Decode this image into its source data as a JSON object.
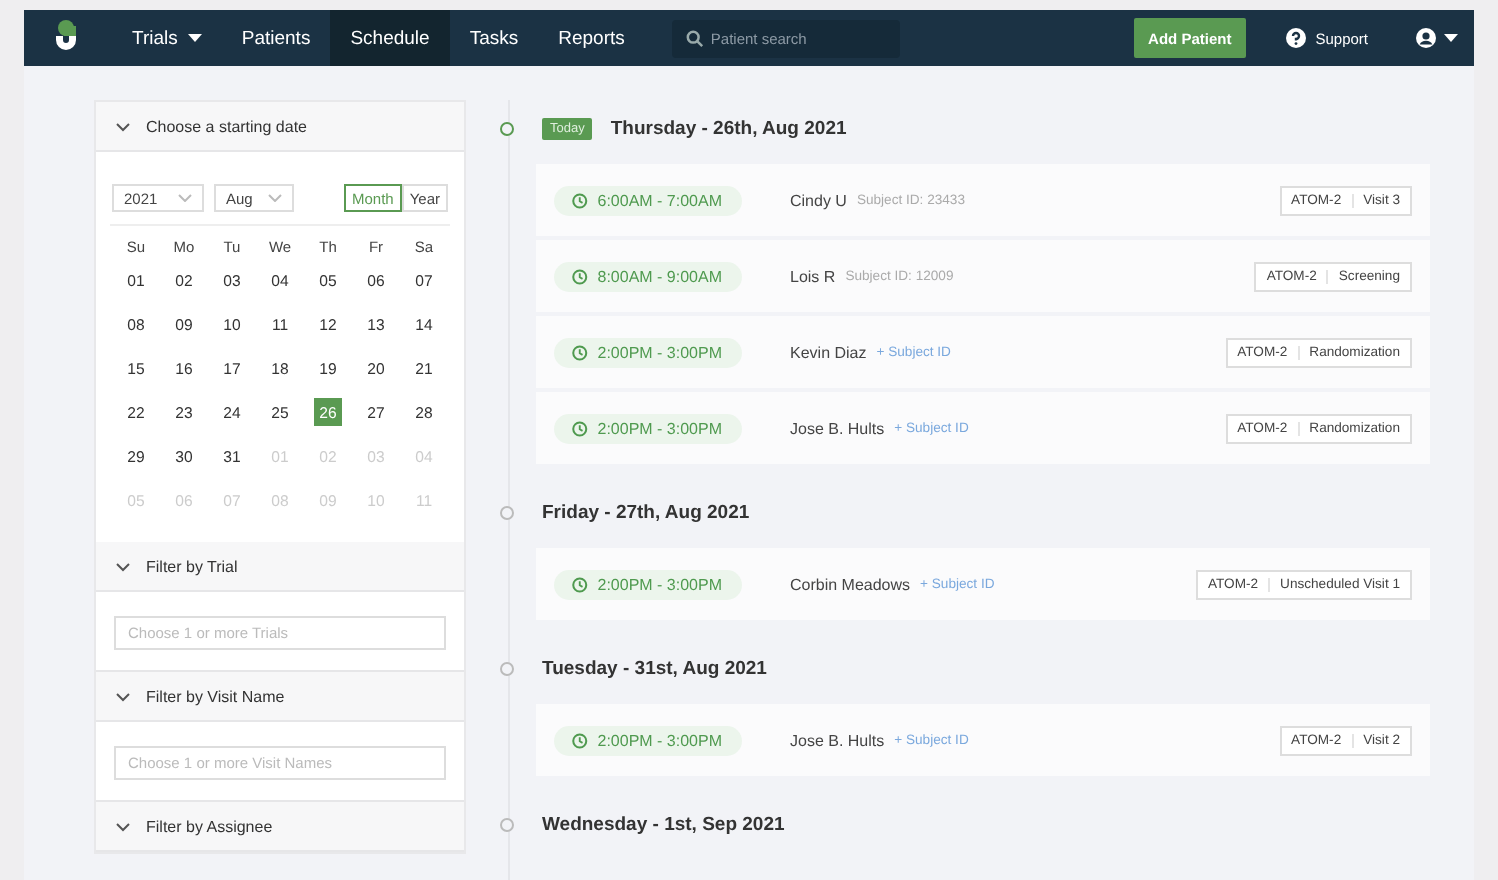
{
  "nav": {
    "items": [
      {
        "label": "Trials",
        "kind": "menu",
        "selected": false
      },
      {
        "label": "Patients",
        "kind": "link",
        "selected": false
      },
      {
        "label": "Schedule",
        "kind": "link",
        "selected": true
      },
      {
        "label": "Tasks",
        "kind": "link",
        "selected": false
      },
      {
        "label": "Reports",
        "kind": "link",
        "selected": false
      }
    ],
    "search": {
      "placeholder": "Patient search"
    },
    "add_button": "Add Patient",
    "support": "Support"
  },
  "sidebar": {
    "date_section": {
      "title": "Choose a starting date",
      "expanded": true,
      "year": "2021",
      "month": "Aug",
      "modes": [
        {
          "label": "Month",
          "selected": true
        },
        {
          "label": "Year",
          "selected": false
        }
      ],
      "weekdays": [
        "Su",
        "Mo",
        "Tu",
        "We",
        "Th",
        "Fr",
        "Sa"
      ],
      "weeks": [
        [
          {
            "d": "01",
            "muted": false,
            "selected": false
          },
          {
            "d": "02",
            "muted": false,
            "selected": false
          },
          {
            "d": "03",
            "muted": false,
            "selected": false
          },
          {
            "d": "04",
            "muted": false,
            "selected": false
          },
          {
            "d": "05",
            "muted": false,
            "selected": false
          },
          {
            "d": "06",
            "muted": false,
            "selected": false
          },
          {
            "d": "07",
            "muted": false,
            "selected": false
          }
        ],
        [
          {
            "d": "08",
            "muted": false,
            "selected": false
          },
          {
            "d": "09",
            "muted": false,
            "selected": false
          },
          {
            "d": "10",
            "muted": false,
            "selected": false
          },
          {
            "d": "11",
            "muted": false,
            "selected": false
          },
          {
            "d": "12",
            "muted": false,
            "selected": false
          },
          {
            "d": "13",
            "muted": false,
            "selected": false
          },
          {
            "d": "14",
            "muted": false,
            "selected": false
          }
        ],
        [
          {
            "d": "15",
            "muted": false,
            "selected": false
          },
          {
            "d": "16",
            "muted": false,
            "selected": false
          },
          {
            "d": "17",
            "muted": false,
            "selected": false
          },
          {
            "d": "18",
            "muted": false,
            "selected": false
          },
          {
            "d": "19",
            "muted": false,
            "selected": false
          },
          {
            "d": "20",
            "muted": false,
            "selected": false
          },
          {
            "d": "21",
            "muted": false,
            "selected": false
          }
        ],
        [
          {
            "d": "22",
            "muted": false,
            "selected": false
          },
          {
            "d": "23",
            "muted": false,
            "selected": false
          },
          {
            "d": "24",
            "muted": false,
            "selected": false
          },
          {
            "d": "25",
            "muted": false,
            "selected": false
          },
          {
            "d": "26",
            "muted": false,
            "selected": true
          },
          {
            "d": "27",
            "muted": false,
            "selected": false
          },
          {
            "d": "28",
            "muted": false,
            "selected": false
          }
        ],
        [
          {
            "d": "29",
            "muted": false,
            "selected": false
          },
          {
            "d": "30",
            "muted": false,
            "selected": false
          },
          {
            "d": "31",
            "muted": false,
            "selected": false
          },
          {
            "d": "01",
            "muted": true,
            "selected": false
          },
          {
            "d": "02",
            "muted": true,
            "selected": false
          },
          {
            "d": "03",
            "muted": true,
            "selected": false
          },
          {
            "d": "04",
            "muted": true,
            "selected": false
          }
        ],
        [
          {
            "d": "05",
            "muted": true,
            "selected": false
          },
          {
            "d": "06",
            "muted": true,
            "selected": false
          },
          {
            "d": "07",
            "muted": true,
            "selected": false
          },
          {
            "d": "08",
            "muted": true,
            "selected": false
          },
          {
            "d": "09",
            "muted": true,
            "selected": false
          },
          {
            "d": "10",
            "muted": true,
            "selected": false
          },
          {
            "d": "11",
            "muted": true,
            "selected": false
          }
        ]
      ]
    },
    "filters": [
      {
        "title": "Filter by Trial",
        "placeholder": "Choose 1 or more Trials"
      },
      {
        "title": "Filter by Visit Name",
        "placeholder": "Choose 1 or more Visit Names"
      },
      {
        "title": "Filter by Assignee"
      }
    ]
  },
  "days": [
    {
      "title": "Thursday - 26th, Aug 2021",
      "badge": "Today",
      "visits": [
        {
          "time": "6:00AM - 7:00AM",
          "name": "Cindy U",
          "subject": "Subject ID: 23433",
          "kind": "id",
          "trial": "ATOM-2",
          "visit": "Visit 3"
        },
        {
          "time": "8:00AM - 9:00AM",
          "name": "Lois R",
          "subject": "Subject ID: 12009",
          "kind": "id",
          "trial": "ATOM-2",
          "visit": "Screening"
        },
        {
          "time": "2:00PM - 3:00PM",
          "name": "Kevin Diaz",
          "subject": "+ Subject ID",
          "kind": "link",
          "trial": "ATOM-2",
          "visit": "Randomization"
        },
        {
          "time": "2:00PM - 3:00PM",
          "name": "Jose B. Hults",
          "subject": "+ Subject ID",
          "kind": "link",
          "trial": "ATOM-2",
          "visit": "Randomization"
        }
      ]
    },
    {
      "title": "Friday - 27th, Aug 2021",
      "visits": [
        {
          "time": "2:00PM - 3:00PM",
          "name": "Corbin Meadows",
          "subject": "+ Subject ID",
          "kind": "link",
          "trial": "ATOM-2",
          "visit": "Unscheduled Visit 1"
        }
      ]
    },
    {
      "title": "Tuesday - 31st, Aug 2021",
      "visits": [
        {
          "time": "2:00PM - 3:00PM",
          "name": "Jose B. Hults",
          "subject": "+ Subject ID",
          "kind": "link",
          "trial": "ATOM-2",
          "visit": "Visit 2"
        }
      ]
    },
    {
      "title": "Wednesday - 1st, Sep 2021"
    }
  ]
}
